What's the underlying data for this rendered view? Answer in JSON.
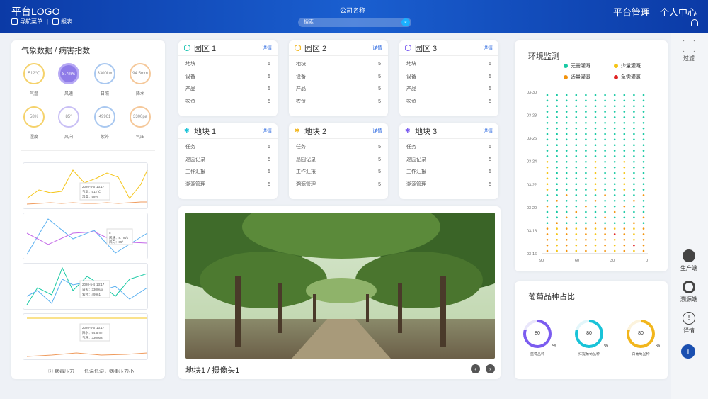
{
  "header": {
    "logo": "平台LOGO",
    "nav_menu": "导航菜单",
    "report": "报表",
    "company": "公司名称",
    "search_placeholder": "搜索",
    "platform_admin": "平台管理",
    "personal_center": "个人中心"
  },
  "weather": {
    "title": "气象数据 / 病害指数",
    "gauges": [
      {
        "value": "512℃",
        "label": "气温"
      },
      {
        "value": "8.7m/s",
        "label": "风速"
      },
      {
        "value": "3300lux",
        "label": "日照"
      },
      {
        "value": "94.5mm",
        "label": "降水"
      },
      {
        "value": "58%",
        "label": "湿度"
      },
      {
        "value": "85°",
        "label": "风向"
      },
      {
        "value": "49961",
        "label": "紫外"
      },
      {
        "value": "3300pa",
        "label": "气压"
      }
    ],
    "tooltips": [
      {
        "date": "2020-5-6",
        "time": "13:17",
        "l1": "气温：512℃",
        "l2": "湿度：58%"
      },
      {
        "date": "5",
        "time": "",
        "l1": "风速：8.7m/s",
        "l2": "风向：85°"
      },
      {
        "date": "2020-5-4",
        "time": "13:17",
        "l1": "日照：3300lux",
        "l2": "紫外：49961"
      },
      {
        "date": "2020-5-6",
        "time": "13:17",
        "l1": "降水：94.5mm",
        "l2": "气压：3300pa"
      }
    ],
    "footer_label": "病毒压力",
    "footer_text": "低温低湿，病毒压力小"
  },
  "parks": [
    {
      "title": "园区 1",
      "link": "详情",
      "color": "#19c3b0",
      "rows": [
        [
          "地块",
          "5"
        ],
        [
          "设备",
          "5"
        ],
        [
          "产品",
          "5"
        ],
        [
          "农资",
          "5"
        ]
      ]
    },
    {
      "title": "园区 2",
      "link": "详情",
      "color": "#f2b61c",
      "rows": [
        [
          "地块",
          "5"
        ],
        [
          "设备",
          "5"
        ],
        [
          "产品",
          "5"
        ],
        [
          "农资",
          "5"
        ]
      ]
    },
    {
      "title": "园区 3",
      "link": "详情",
      "color": "#7a5cf0",
      "rows": [
        [
          "地块",
          "5"
        ],
        [
          "设备",
          "5"
        ],
        [
          "产品",
          "5"
        ],
        [
          "农资",
          "5"
        ]
      ]
    }
  ],
  "plots": [
    {
      "title": "地块 1",
      "link": "详情",
      "color": "#19c3d8",
      "rows": [
        [
          "任务",
          "5"
        ],
        [
          "巡园记录",
          "5"
        ],
        [
          "工作汇报",
          "5"
        ],
        [
          "溯源管理",
          "5"
        ]
      ]
    },
    {
      "title": "地块 2",
      "link": "详情",
      "color": "#f2b61c",
      "rows": [
        [
          "任务",
          "5"
        ],
        [
          "巡园记录",
          "5"
        ],
        [
          "工作汇报",
          "5"
        ],
        [
          "溯源管理",
          "5"
        ]
      ]
    },
    {
      "title": "地块 3",
      "link": "详情",
      "color": "#7a5cf0",
      "rows": [
        [
          "任务",
          "5"
        ],
        [
          "巡园记录",
          "5"
        ],
        [
          "工作汇报",
          "5"
        ],
        [
          "溯源管理",
          "5"
        ]
      ]
    }
  ],
  "camera": {
    "label": "地块1 / 摄像头1"
  },
  "env": {
    "title": "环境监测",
    "legend": [
      {
        "label": "无需灌溉",
        "color": "#19c9a4"
      },
      {
        "label": "少量灌溉",
        "color": "#f5c518"
      },
      {
        "label": "适量灌溉",
        "color": "#f2920c"
      },
      {
        "label": "急需灌溉",
        "color": "#e02424"
      }
    ],
    "y_ticks": [
      "03-30",
      "03-28",
      "03-26",
      "03-24",
      "03-22",
      "03-20",
      "03-18",
      "03-16"
    ],
    "x_ticks": [
      "90",
      "60",
      "30",
      "0"
    ]
  },
  "variety": {
    "title": "葡萄品种占比",
    "unit": "%",
    "items": [
      {
        "value": "80",
        "label": "蓝莓品种",
        "color": "#7b5cf0"
      },
      {
        "value": "80",
        "label": "红提葡萄品种",
        "color": "#19c3d8"
      },
      {
        "value": "80",
        "label": "白葡萄品种",
        "color": "#f2b61c"
      }
    ]
  },
  "sidebar": {
    "filter": "过滤",
    "producer": "生产端",
    "traceability": "溯源端",
    "details": "详情"
  }
}
